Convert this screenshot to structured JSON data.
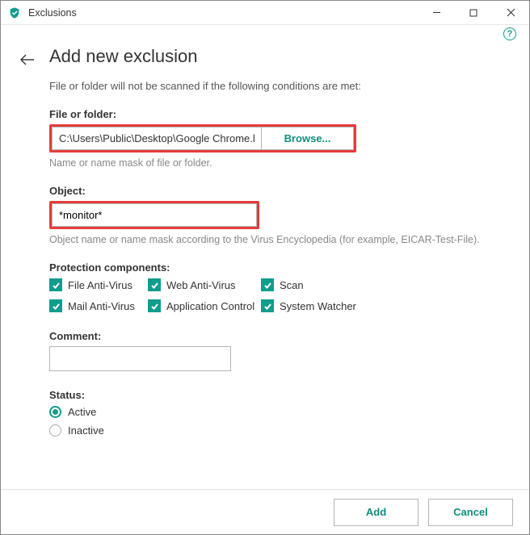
{
  "titlebar": {
    "title": "Exclusions"
  },
  "page": {
    "heading": "Add new exclusion",
    "description": "File or folder will not be scanned if the following conditions are met:"
  },
  "file_folder": {
    "label": "File or folder:",
    "value": "C:\\Users\\Public\\Desktop\\Google Chrome.lnk",
    "browse_label": "Browse...",
    "hint": "Name or name mask of file or folder."
  },
  "object": {
    "label": "Object:",
    "value": "*monitor*",
    "hint": "Object name or name mask according to the Virus Encyclopedia (for example, EICAR-Test-File)."
  },
  "components": {
    "label": "Protection components:",
    "items": [
      {
        "label": "File Anti-Virus",
        "checked": true
      },
      {
        "label": "Web Anti-Virus",
        "checked": true
      },
      {
        "label": "Scan",
        "checked": true
      },
      {
        "label": "Mail Anti-Virus",
        "checked": true
      },
      {
        "label": "Application Control",
        "checked": true
      },
      {
        "label": "System Watcher",
        "checked": true
      }
    ]
  },
  "comment": {
    "label": "Comment:",
    "value": ""
  },
  "status": {
    "label": "Status:",
    "options": [
      {
        "label": "Active",
        "selected": true
      },
      {
        "label": "Inactive",
        "selected": false
      }
    ]
  },
  "footer": {
    "add_label": "Add",
    "cancel_label": "Cancel"
  }
}
